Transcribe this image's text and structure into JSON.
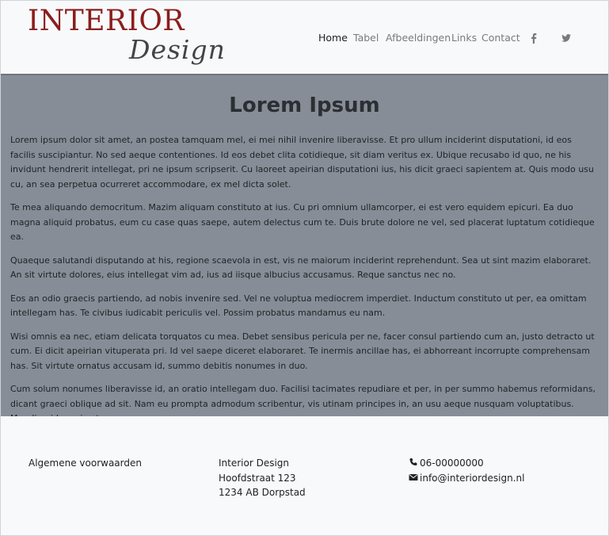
{
  "brand": {
    "line1": "INTERIOR",
    "line2": "Design",
    "color_primary": "#8b1d1d"
  },
  "nav": {
    "items": [
      {
        "label": "Home",
        "active": true
      },
      {
        "label": "Tabel",
        "active": false
      },
      {
        "label": "Afbeeldingen",
        "active": false
      },
      {
        "label": "Links",
        "active": false
      },
      {
        "label": "Contact",
        "active": false
      }
    ],
    "icons": [
      "facebook-icon",
      "twitter-icon"
    ]
  },
  "main": {
    "title": "Lorem Ipsum",
    "paragraphs": [
      "Lorem ipsum dolor sit amet, an postea tamquam mel, ei mei nihil invenire liberavisse. Et pro ullum inciderint disputationi, id eos facilis suscipiantur. No sed aeque contentiones. Id eos debet clita cotidieque, sit diam veritus ex. Ubique recusabo id quo, ne his invidunt hendrerit intellegat, pri ne ipsum scripserit. Cu laoreet apeirian disputationi ius, his dicit graeci sapientem at. Quis modo usu cu, an sea perpetua ocurreret accommodare, ex mel dicta solet.",
      "Te mea aliquando democritum. Mazim aliquam constituto at ius. Cu pri omnium ullamcorper, ei est vero equidem epicuri. Ea duo magna aliquid probatus, eum cu case quas saepe, autem delectus cum te. Duis brute dolore ne vel, sed placerat luptatum cotidieque ea.",
      "Quaeque salutandi disputando at his, regione scaevola in est, vis ne maiorum inciderint reprehendunt. Sea ut sint mazim elaboraret. An sit virtute dolores, eius intellegat vim ad, ius ad iisque albucius accusamus. Reque sanctus nec no.",
      "Eos an odio graecis partiendo, ad nobis invenire sed. Vel ne voluptua mediocrem imperdiet. Inductum constituto ut per, ea omittam intellegam has. Te civibus iudicabit periculis vel. Possim probatus mandamus eu nam.",
      "Wisi omnis ea nec, etiam delicata torquatos cu mea. Debet sensibus pericula per ne, facer consul partiendo cum an, justo detracto ut cum. Ei dicit apeirian vituperata pri. Id vel saepe diceret elaboraret. Te inermis ancillae has, ei abhorreant incorrupte comprehensam has. Sit virtute ornatus accusam id, summo debitis nonumes in duo.",
      "Cum solum nonumes liberavisse id, an oratio intellegam duo. Facilisi tacimates repudiare et per, in per summo habemus reformidans, dicant graeci oblique ad sit. Nam eu prompta admodum scribentur, vis utinam principes in, an usu aeque nusquam voluptatibus. Mundi quidam vix at."
    ]
  },
  "footer": {
    "terms_link": "Algemene voorwaarden",
    "address": [
      "Interior Design",
      "Hoofdstraat 123",
      "1234 AB Dorpstad"
    ],
    "phone": "06-00000000",
    "email": "info@interiordesign.nl"
  },
  "colors": {
    "main_bg": "#868d96",
    "page_bg": "#f8f9fa"
  }
}
